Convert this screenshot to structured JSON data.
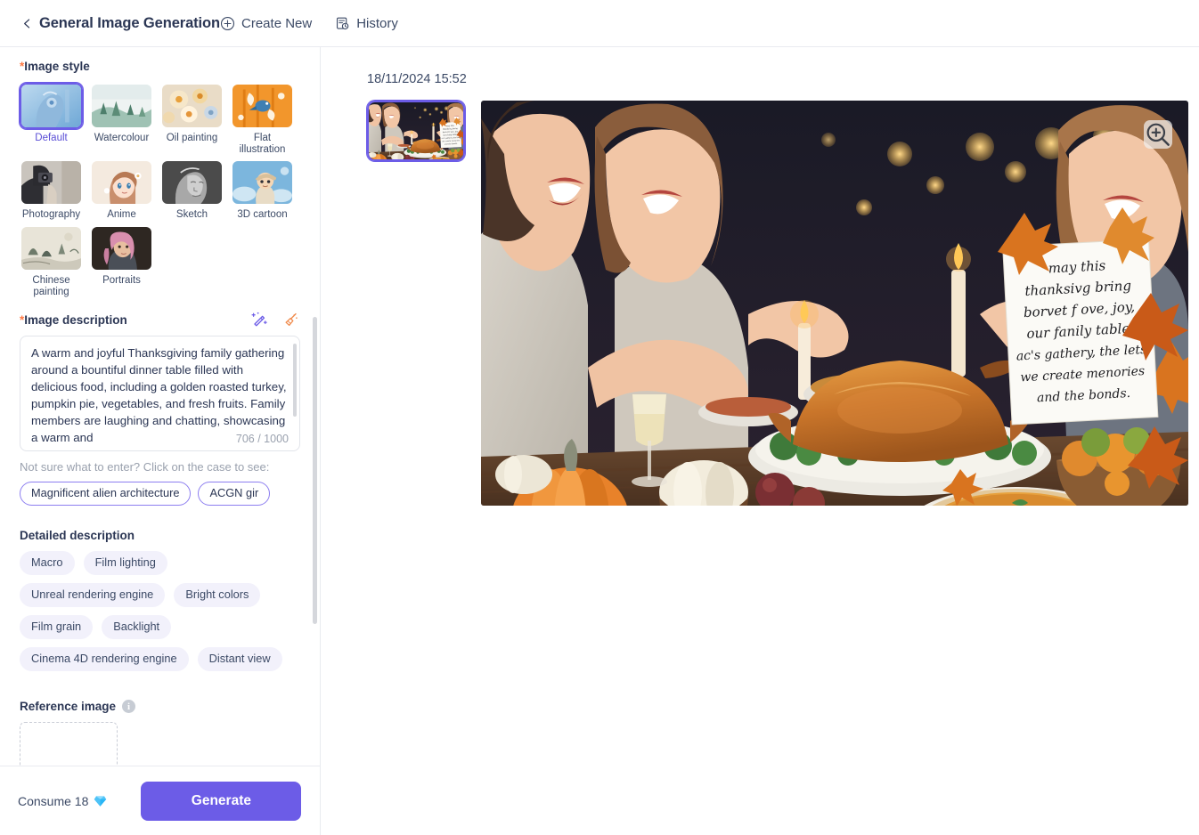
{
  "header": {
    "back_icon": "chevron-left-icon",
    "title": "General Image Generation",
    "create_new": "Create New",
    "create_new_icon": "circle-plus-icon",
    "history": "History",
    "history_icon": "history-icon"
  },
  "sidebar": {
    "image_style": {
      "label": "Image style",
      "required_mark": "*",
      "selected": "Default",
      "options": [
        {
          "label": "Default",
          "selected": true
        },
        {
          "label": "Watercolour",
          "selected": false
        },
        {
          "label": "Oil painting",
          "selected": false
        },
        {
          "label": "Flat illustration",
          "selected": false
        },
        {
          "label": "Photography",
          "selected": false
        },
        {
          "label": "Anime",
          "selected": false
        },
        {
          "label": "Sketch",
          "selected": false
        },
        {
          "label": "3D cartoon",
          "selected": false
        },
        {
          "label": "Chinese painting",
          "selected": false
        },
        {
          "label": "Portraits",
          "selected": false
        }
      ]
    },
    "image_description": {
      "label": "Image description",
      "required_mark": "*",
      "enhance_icon": "magic-wand-icon",
      "clear_icon": "broom-icon",
      "value": "A warm and joyful Thanksgiving family gathering around a bountiful dinner table filled with delicious food, including a golden roasted turkey, pumpkin pie, vegetables, and fresh fruits. Family members are laughing and chatting, showcasing a warm and",
      "char_count": "706 / 1000",
      "hint": "Not sure what to enter? Click on the case to see:",
      "examples": [
        "Magnificent alien architecture",
        "ACGN gir"
      ]
    },
    "detailed_description": {
      "label": "Detailed description",
      "tags": [
        "Macro",
        "Film lighting",
        "Unreal rendering engine",
        "Bright colors",
        "Film grain",
        "Backlight",
        "Cinema 4D rendering engine",
        "Distant view"
      ]
    },
    "reference_image": {
      "label": "Reference image",
      "info_icon": "info-icon",
      "info_glyph": "i",
      "upload_box": "upload-dropzone"
    },
    "footer": {
      "consume_label": "Consume 18",
      "gem_icon": "diamond-icon",
      "generate_label": "Generate"
    }
  },
  "result": {
    "timestamp": "18/11/2024 15:52",
    "thumbnail": {
      "name": "result-thumbnail",
      "selected": true
    },
    "zoom_icon": "magnifier-plus-icon",
    "image": {
      "alt": "Thanksgiving family gathering with roasted turkey, pumpkin pie and pumpkins",
      "sign_text": [
        "may this",
        "thanksivg bring",
        "borvet f ove, joy,",
        "our fanily table,",
        "ac's gathery, the lets",
        "we create menories",
        "and the bonds."
      ]
    }
  },
  "colors": {
    "accent": "#6c5ce7",
    "required": "#ff7a45",
    "text": "#2b3654",
    "muted": "#9aa1ae",
    "tag_bg": "#f2f1fb",
    "border": "#e9ebf0"
  }
}
